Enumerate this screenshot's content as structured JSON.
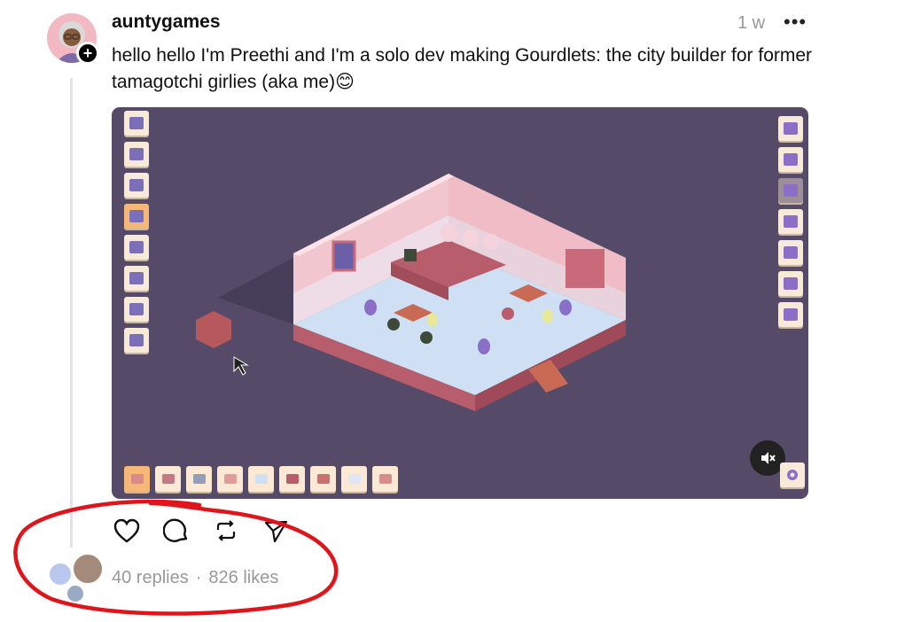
{
  "post": {
    "username": "auntygames",
    "timestamp": "1 w",
    "more_label": "•••",
    "text": "hello hello I'm Preethi and I'm a solo dev making Gourdlets: the city builder for former tamagotchi girlies (aka me)😊",
    "follow_label": "+"
  },
  "media": {
    "left_tools": [
      "road-icon",
      "wall-icon",
      "bed-icon",
      "table-icon",
      "cupcake-icon",
      "frame-icon",
      "fence-icon",
      "trash-icon"
    ],
    "right_tools": [
      "steam-icon",
      "undo-icon",
      "redo-icon",
      "camera-icon",
      "eye-icon",
      "grid-icon",
      "door-icon"
    ],
    "tiles": [
      "#d98a8a",
      "#c47a86",
      "#8fa0b8",
      "#e29b9b",
      "#cfe0f0",
      "#b85d6b",
      "#c97070",
      "#dce6f5",
      "#d88c8c"
    ],
    "mute_label": "🔇",
    "settings_icon": "gear-icon"
  },
  "actions": [
    "like-icon",
    "reply-icon",
    "repost-icon",
    "share-icon"
  ],
  "stats": {
    "replies": "40 replies",
    "separator": "·",
    "likes": "826 likes"
  },
  "colors": {
    "scene_bg": "#554b68",
    "floor": "#cfe0f5",
    "wall": "#f2c6cf",
    "annotation": "#e0141a"
  }
}
